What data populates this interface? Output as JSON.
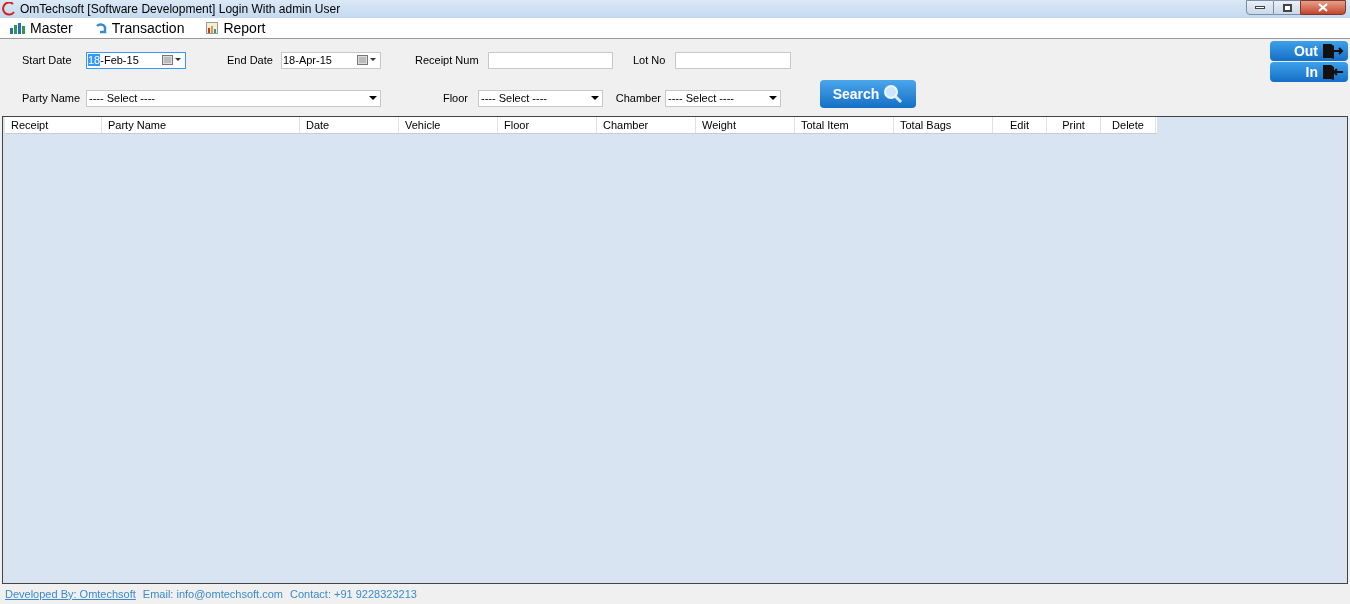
{
  "window": {
    "title": "OmTechsoft [Software Development] Login With admin User"
  },
  "menu": [
    {
      "label": "Master",
      "kind": "master"
    },
    {
      "label": "Transaction",
      "kind": "transaction"
    },
    {
      "label": "Report",
      "kind": "report"
    }
  ],
  "filters": {
    "start_date": {
      "label": "Start Date",
      "value": "18-Feb-15",
      "focused": true
    },
    "end_date": {
      "label": "End Date",
      "value": "18-Apr-15",
      "focused": false
    },
    "receipt_num": {
      "label": "Receipt Num"
    },
    "lot_no": {
      "label": "Lot No"
    },
    "party_name": {
      "label": "Party Name",
      "value": "---- Select ----"
    },
    "floor": {
      "label": "Floor",
      "value": "---- Select ----"
    },
    "chamber": {
      "label": "Chamber",
      "value": "---- Select ----"
    },
    "search_button": "Search"
  },
  "side_buttons": [
    {
      "label": "Out",
      "kind": "out"
    },
    {
      "label": "In",
      "kind": "in"
    }
  ],
  "table": {
    "columns": [
      "Receipt",
      "Party Name",
      "Date",
      "Vehicle",
      "Floor",
      "Chamber",
      "Weight",
      "Total Item",
      "Total Bags",
      "Edit",
      "Print",
      "Delete"
    ]
  },
  "status_bar": {
    "link": "Developed By: Omtechsoft",
    "email": "Email: info@omtechsoft.com",
    "contact": "Contact: +91 9228323213"
  }
}
